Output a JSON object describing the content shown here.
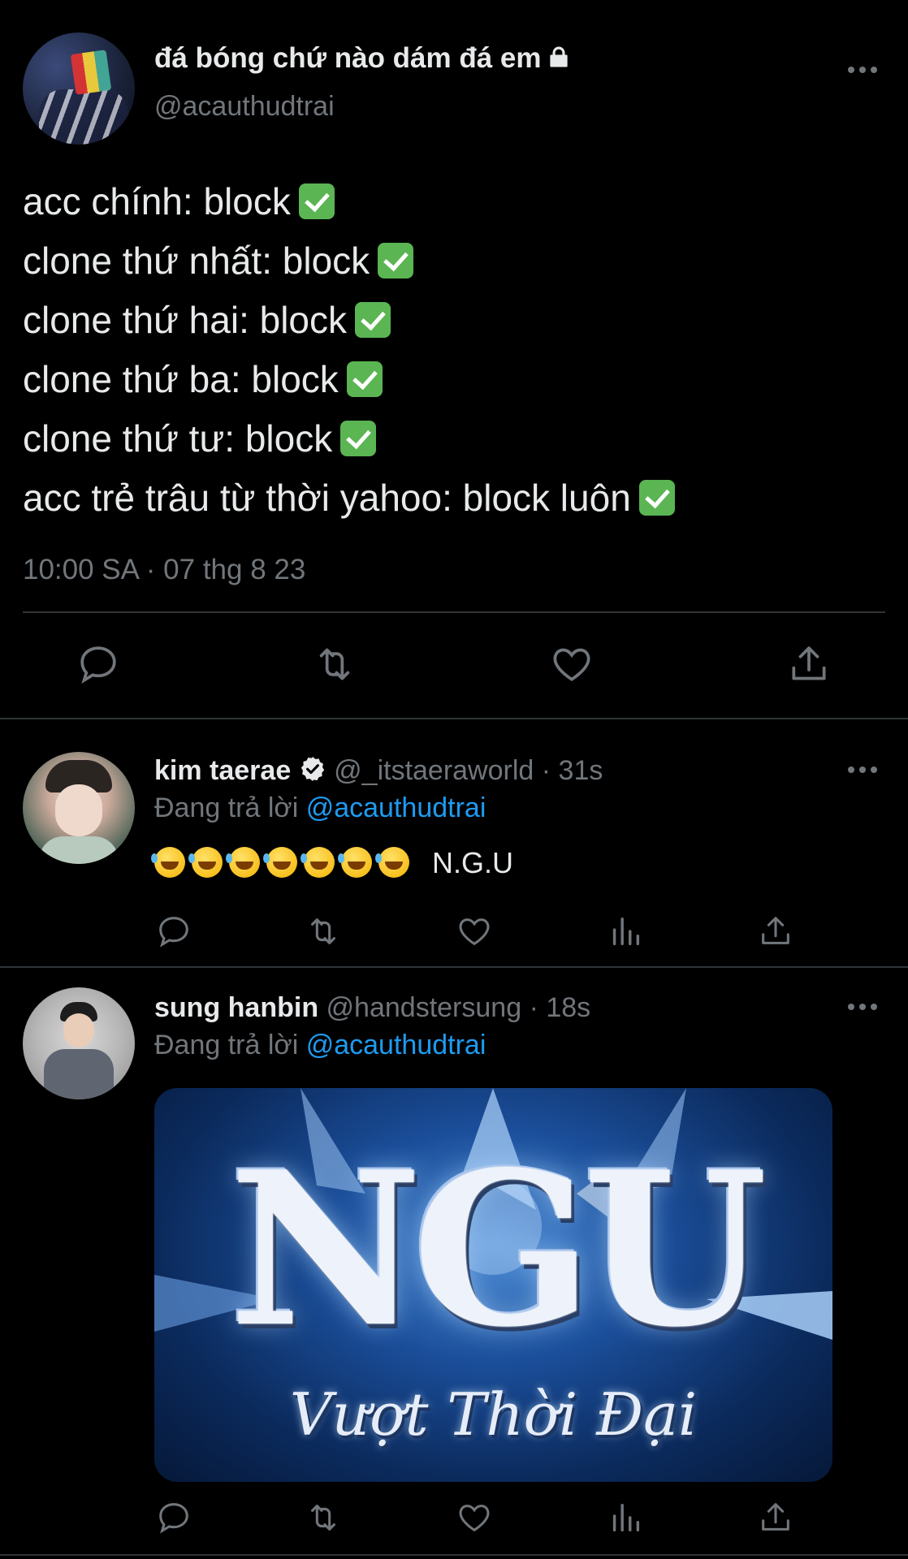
{
  "main_tweet": {
    "display_name": "đá bóng chứ nào dám đá em",
    "handle": "@acauthudtrai",
    "lines": [
      "acc chính: block",
      "clone thứ nhất: block",
      "clone thứ hai: block",
      "clone thứ ba: block",
      "clone thứ tư: block",
      "acc trẻ trâu từ thời yahoo: block luôn"
    ],
    "timestamp": "10:00 SA · 07 thg 8 23"
  },
  "replies": [
    {
      "display_name": "kim taerae",
      "handle": "@_itstaeraworld",
      "time": "· 31s",
      "replying_prefix": "Đang trả lời",
      "replying_to": "@acauthudtrai",
      "text": "N.G.U",
      "emoji_count": 7
    },
    {
      "display_name": "sung hanbin",
      "handle": "@handstersung",
      "time": "· 18s",
      "replying_prefix": "Đang trả lời",
      "replying_to": "@acauthudtrai",
      "image_title": "NGU",
      "image_subtitle": "Vượt Thời Đại"
    }
  ],
  "colors": {
    "background": "#000000",
    "text": "#e7e9ea",
    "muted": "#71767b",
    "link": "#1d9bf0",
    "divider": "#2f3336"
  }
}
